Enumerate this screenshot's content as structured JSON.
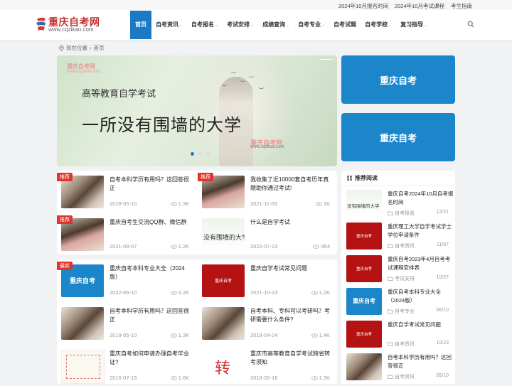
{
  "topbar": {
    "links": [
      "2024年10月报名时间",
      "2024年10月考试课程",
      "考生指南"
    ]
  },
  "logo": {
    "name": "重庆自考网",
    "domain": "www.cqzikao.com"
  },
  "nav": {
    "items": [
      {
        "label": "首页",
        "active": true,
        "caret": false
      },
      {
        "label": "自考资讯",
        "caret": true
      },
      {
        "label": "自考报名",
        "caret": true
      },
      {
        "label": "考试安排",
        "caret": true
      },
      {
        "label": "成绩查询",
        "caret": true
      },
      {
        "label": "自考专业",
        "caret": true
      },
      {
        "label": "自考试题",
        "caret": false
      },
      {
        "label": "自考学校",
        "caret": true
      },
      {
        "label": "复习指导",
        "caret": true
      }
    ],
    "caret_glyph": "⌄"
  },
  "breadcrumb": {
    "prefix": "现在位置",
    "current": "首页"
  },
  "banner": {
    "subtitle": "高等教育自学考试",
    "headline": "一所没有围墙的大学",
    "watermark_name": "重庆自考网",
    "watermark_domain": "www.cqzikao.com",
    "slides": 3,
    "active_slide": 0
  },
  "ads": [
    "重庆自考",
    "重庆自考"
  ],
  "featured": [
    {
      "title": "自考本科学历有用吗？这回答很正",
      "date": "2018-05-10",
      "views": "1.3K",
      "tag": "推荐",
      "thumb": "photo"
    },
    {
      "title": "我收集了近10000套自考历年真题助你通过考试!",
      "date": "2021-11-03",
      "views": "1K",
      "tag": "推荐",
      "thumb": "photo2"
    },
    {
      "title": "重庆自考生交流QQ群、微信群",
      "date": "2021-09-07",
      "views": "1.2K",
      "tag": "推荐",
      "thumb": "photo2"
    },
    {
      "title": "什么是自学考试",
      "date": "2022-07-23",
      "views": "964",
      "tag": "",
      "thumb": "text",
      "thumb_text": "没有围墙的大学"
    }
  ],
  "latest": [
    {
      "title": "重庆自考本科专业大全（2024版）",
      "date": "2022-06-10",
      "views": "3.2K",
      "tag": "最新",
      "thumb": "blue",
      "thumb_text": "重庆自考"
    },
    {
      "title": "重庆自学考试常见问题",
      "date": "2021-10-23",
      "views": "1.2K",
      "tag": "",
      "thumb": "red",
      "thumb_text": "重庆自考"
    },
    {
      "title": "自考本科学历有用吗？这回答很正",
      "date": "2018-05-10",
      "views": "1.3K",
      "tag": "",
      "thumb": "photo"
    },
    {
      "title": "自考本科、专科可以考研吗？考研需要什么条件?",
      "date": "2018-04-24",
      "views": "1.4K",
      "tag": "",
      "thumb": "photo"
    },
    {
      "title": "重庆自考如何申请办理自考毕业证?",
      "date": "2016-07-19",
      "views": "1.6K",
      "tag": "",
      "thumb": "cert"
    },
    {
      "title": "重庆市高等教育自学考试跨省转考须知",
      "date": "2016-02-16",
      "views": "1.3K",
      "tag": "",
      "thumb": "zhuan",
      "thumb_text": "转"
    }
  ],
  "sidebar": {
    "title": "推荐阅读",
    "items": [
      {
        "title": "重庆自考2024年10月自考报名时间",
        "category": "自考报名",
        "date": "12/21",
        "thumb": "text",
        "thumb_text": "没有围墙的大学"
      },
      {
        "title": "重庆理工大学自学考试学士学位申请条件",
        "category": "自考资讯",
        "date": "11/07",
        "thumb": "red",
        "thumb_text": "重庆自考"
      },
      {
        "title": "重庆自考2023年4月自考考试课程安排表",
        "category": "考试安排",
        "date": "10/27",
        "thumb": "red",
        "thumb_text": "重庆自考"
      },
      {
        "title": "重庆自考本科专业大全（2024版）",
        "category": "自考专业",
        "date": "06/10",
        "thumb": "blue",
        "thumb_text": "重庆自考"
      },
      {
        "title": "重庆自学考试常见问题",
        "category": "自考资讯",
        "date": "10/23",
        "thumb": "red",
        "thumb_text": "重庆自考"
      },
      {
        "title": "自考本科学历有用吗？这回答很正",
        "category": "自考资讯",
        "date": "05/10",
        "thumb": "photo"
      }
    ]
  },
  "colors": {
    "brand_blue": "#1c7ac4",
    "ad_blue": "#1b86ca",
    "logo_red": "#c62f2f",
    "tag_red": "#e0342c",
    "thumb_red": "#b51313"
  },
  "icons": {
    "search": "search-icon",
    "location": "location-pin-icon",
    "eye": "eye-icon",
    "folder": "folder-icon",
    "grid": "grid-icon"
  }
}
